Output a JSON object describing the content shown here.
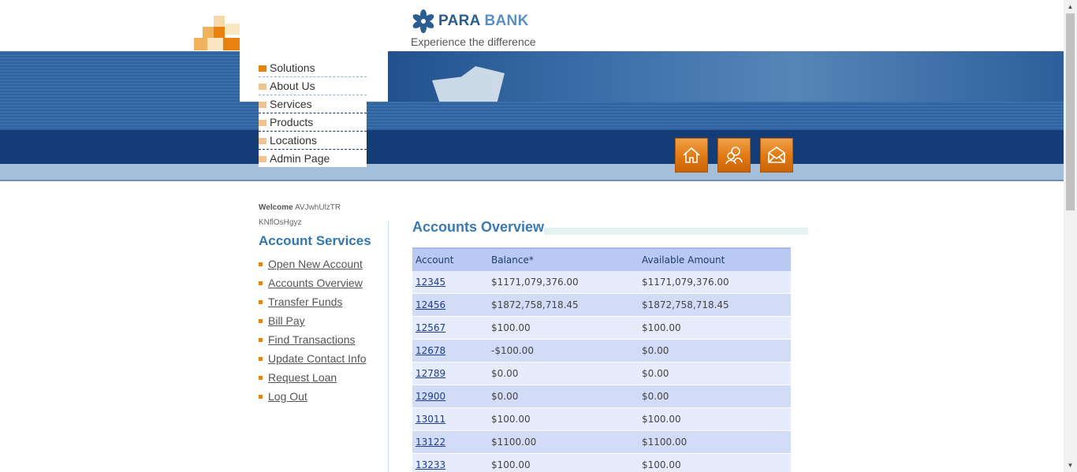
{
  "brand": {
    "name_part1": "PARA",
    "name_part2": "BANK",
    "tagline": "Experience the difference"
  },
  "menu": [
    {
      "label": "Solutions",
      "active": true
    },
    {
      "label": "About Us"
    },
    {
      "label": "Services"
    },
    {
      "label": "Products"
    },
    {
      "label": "Locations"
    },
    {
      "label": "Admin Page"
    }
  ],
  "header_icons": [
    "home-icon",
    "about-icon",
    "contact-icon"
  ],
  "welcome": {
    "label": "Welcome",
    "first": "AVJwhUlzTR",
    "last": "KNflOsHgyz"
  },
  "services": {
    "title": "Account Services",
    "links": [
      "Open New Account",
      "Accounts Overview",
      "Transfer Funds",
      "Bill Pay",
      "Find Transactions",
      "Update Contact Info",
      "Request Loan",
      "Log Out"
    ]
  },
  "overview": {
    "title": "Accounts Overview",
    "headers": [
      "Account",
      "Balance*",
      "Available Amount"
    ],
    "rows": [
      [
        "12345",
        "$1171,079,376.00",
        "$1171,079,376.00"
      ],
      [
        "12456",
        "$1872,758,718.45",
        "$1872,758,718.45"
      ],
      [
        "12567",
        "$100.00",
        "$100.00"
      ],
      [
        "12678",
        "-$100.00",
        "$0.00"
      ],
      [
        "12789",
        "$0.00",
        "$0.00"
      ],
      [
        "12900",
        "$0.00",
        "$0.00"
      ],
      [
        "13011",
        "$100.00",
        "$100.00"
      ],
      [
        "13122",
        "$1100.00",
        "$1100.00"
      ],
      [
        "13233",
        "$100.00",
        "$100.00"
      ]
    ]
  },
  "colors": {
    "accent": "#e8820c",
    "brand_blue": "#2a5d92",
    "table_header": "#b9c9f4"
  }
}
